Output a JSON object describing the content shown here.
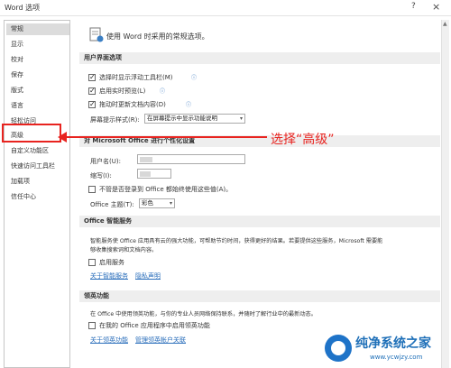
{
  "window": {
    "title": "Word 选项",
    "help_glyph": "?",
    "close_glyph": "×"
  },
  "sidebar": {
    "items": [
      {
        "label": "常规"
      },
      {
        "label": "显示"
      },
      {
        "label": "校对"
      },
      {
        "label": "保存"
      },
      {
        "label": "版式"
      },
      {
        "label": "语言"
      },
      {
        "label": "轻松访问"
      },
      {
        "label": "高级"
      },
      {
        "label": "自定义功能区"
      },
      {
        "label": "快速访问工具栏"
      },
      {
        "label": "加载项"
      },
      {
        "label": "信任中心"
      }
    ],
    "active_index": 0
  },
  "header": {
    "text": "使用 Word 时采用的常规选项。"
  },
  "ui_section": {
    "title": "用户界面选项",
    "options": [
      {
        "label": "选择时显示浮动工具栏(M)",
        "checked": true
      },
      {
        "label": "启用实时预览(L)",
        "checked": true
      },
      {
        "label": "拖动时更新文档内容(D)",
        "checked": true
      }
    ],
    "tooltip_label": "屏幕提示样式(R):",
    "tooltip_value": "在屏幕提示中显示功能说明",
    "info_glyph": "ⓘ"
  },
  "personalize_section": {
    "title": "对 Microsoft Office 进行个性化设置",
    "username_label": "用户名(U):",
    "initials_label": "缩写(I):",
    "signin_label": "不管是否登录到 Office 都始终使用这些值(A)。",
    "signin_checked": false,
    "theme_label": "Office 主题(T):",
    "theme_value": "彩色"
  },
  "intelligent_section": {
    "title": "Office 智能服务",
    "desc_line1": "智能服务使 Office 应用具有云的强大功能，可帮助节约时间，获得更好的结果。若要提供这些服务，Microsoft 需要能",
    "desc_line2": "够收集搜索词和文档内容。",
    "enable_label": "启用服务",
    "enable_checked": false,
    "link": "关于智能服务",
    "link2": "隐私声明"
  },
  "linkedin_section": {
    "title": "领英功能",
    "desc": "在 Office 中使用领英功能，与你的专业人员网络保持联系，并随时了解行业中的最新动态。",
    "enable_label": "在我的 Office 应用程序中启用领英功能",
    "enable_checked": false,
    "link": "关于领英功能",
    "link2": "管理领英帐户关联"
  },
  "annotation": {
    "text": "选择“高级”",
    "color": "#e8231f"
  },
  "watermark": {
    "title": "纯净系统之家",
    "url": "www.ycwjzy.com"
  }
}
